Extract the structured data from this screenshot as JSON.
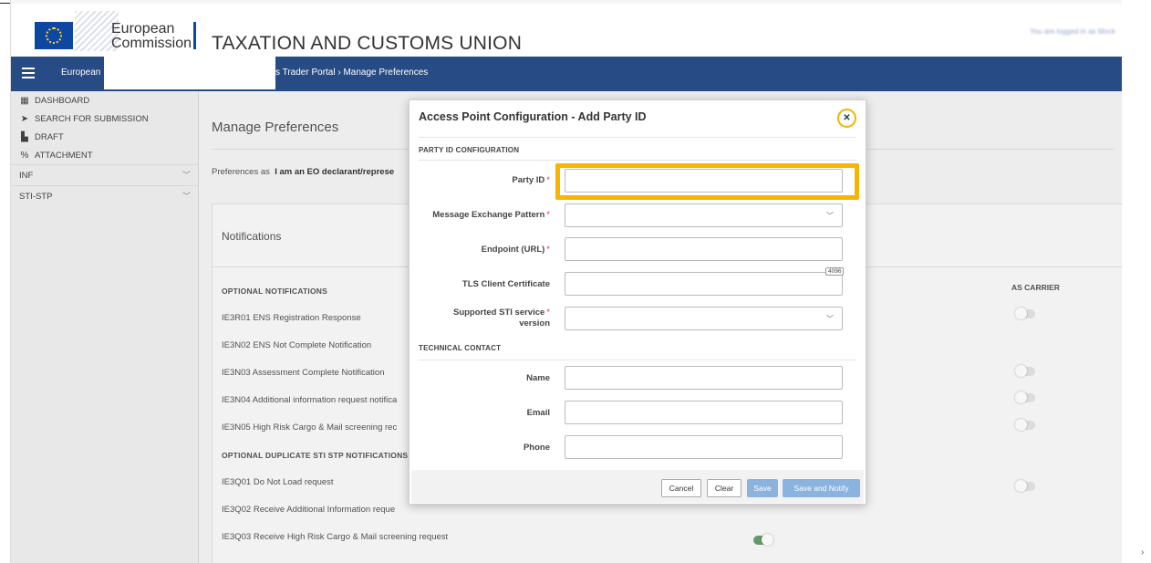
{
  "header": {
    "org_name": "European\nCommission",
    "app_title": "TAXATION AND CUSTOMS UNION",
    "login_status": "You are logged in as Mock"
  },
  "nav": {
    "breadcrumb_start": "European",
    "breadcrumb_rest": "s Trader Portal  ›  Manage Preferences"
  },
  "sidebar": {
    "items": [
      {
        "label": "DASHBOARD",
        "icon": "dashboard-icon",
        "glyph": "▦"
      },
      {
        "label": "SEARCH FOR SUBMISSION",
        "icon": "send-icon",
        "glyph": "➤"
      },
      {
        "label": "DRAFT",
        "icon": "document-icon",
        "glyph": "▙"
      },
      {
        "label": "ATTACHMENT",
        "icon": "attachment-icon",
        "glyph": "%"
      },
      {
        "label": "INF",
        "icon": "",
        "glyph": ""
      },
      {
        "label": "STI-STP",
        "icon": "",
        "glyph": ""
      }
    ],
    "chevron": "﹀"
  },
  "main": {
    "title": "Manage Preferences",
    "preferences_as_label": "Preferences as",
    "preferences_as_value": "I am an EO declarant/represe",
    "notifications_title": "Notifications",
    "as_carrier_header": "AS CARRIER",
    "rows": [
      {
        "label": "OPTIONAL NOTIFICATIONS",
        "head": true
      },
      {
        "label": "IE3R01 ENS Registration Response"
      },
      {
        "label": "IE3N02 ENS Not Complete Notification"
      },
      {
        "label": "IE3N03 Assessment Complete Notification"
      },
      {
        "label": "IE3N04 Additional information request notifica"
      },
      {
        "label": "IE3N05 High Risk Cargo & Mail screening rec"
      },
      {
        "label": "OPTIONAL DUPLICATE STI STP NOTIFICATIONS",
        "head": true
      },
      {
        "label": "IE3Q01 Do Not Load request"
      },
      {
        "label": "IE3Q02 Receive Additional Information reque"
      },
      {
        "label": "IE3Q03 Receive High Risk Cargo & Mail screening request"
      }
    ]
  },
  "modal": {
    "title": "Access Point Configuration - Add Party ID",
    "close_symbol": "✕",
    "section_party": "PARTY ID CONFIGURATION",
    "section_contact": "TECHNICAL CONTACT",
    "fields": {
      "party_id": {
        "label": "Party ID",
        "value": "",
        "required": "*"
      },
      "mep": {
        "label": "Message Exchange Pattern",
        "value": "",
        "required": "*"
      },
      "endpoint": {
        "label": "Endpoint (URL)",
        "value": "",
        "required": "*"
      },
      "tls": {
        "label": "TLS Client Certificate",
        "value": "",
        "counter": "4096"
      },
      "sti_version": {
        "label": "Supported STI service version",
        "value": "",
        "required": "*"
      },
      "name": {
        "label": "Name",
        "value": ""
      },
      "email": {
        "label": "Email",
        "value": ""
      },
      "phone": {
        "label": "Phone",
        "value": ""
      }
    },
    "buttons": {
      "cancel": "Cancel",
      "clear": "Clear",
      "save": "Save",
      "save_notify": "Save and Notify"
    },
    "highlight_color": "#f7b500"
  }
}
